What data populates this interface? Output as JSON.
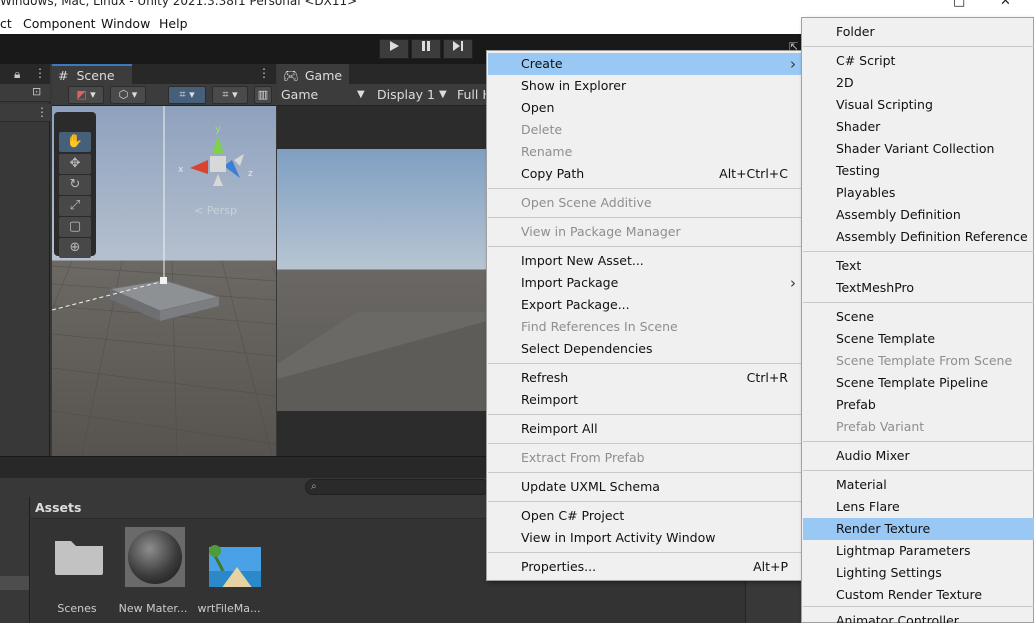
{
  "window": {
    "title": "Windows, Mac, Linux - Unity 2021.3.38f1 Personal <DX11>",
    "minimize_glyph": "□",
    "close_glyph": "✕"
  },
  "menubar": [
    "ct",
    "Component",
    "Window",
    "Help"
  ],
  "toolbar": {
    "play_icon": "play-icon",
    "pause_icon": "pause-icon",
    "step_icon": "step-icon"
  },
  "scene": {
    "tab_label": "Scene",
    "persp_label": "< Persp",
    "gizmo": {
      "x": "x",
      "y": "y",
      "z": "z"
    }
  },
  "game": {
    "tab_label": "Game",
    "mode": "Game",
    "display": "Display 1",
    "aspect": "Full H"
  },
  "project": {
    "header": "Assets",
    "search_placeholder": "",
    "assets": [
      {
        "name": "Scenes",
        "icon": "folder-icon"
      },
      {
        "name": "New Mater...",
        "icon": "material-sphere-icon"
      },
      {
        "name": "wrtFileMa...",
        "icon": "video-clip-icon"
      }
    ]
  },
  "context_menu": {
    "items": [
      {
        "label": "Create",
        "submenu": true,
        "highlighted": true
      },
      {
        "label": "Show in Explorer"
      },
      {
        "label": "Open"
      },
      {
        "label": "Delete",
        "disabled": true
      },
      {
        "label": "Rename",
        "disabled": true
      },
      {
        "label": "Copy Path",
        "shortcut": "Alt+Ctrl+C"
      },
      {
        "label": "Open Scene Additive",
        "disabled": true
      },
      {
        "label": "View in Package Manager",
        "disabled": true
      },
      {
        "label": "Import New Asset..."
      },
      {
        "label": "Import Package",
        "submenu": true
      },
      {
        "label": "Export Package..."
      },
      {
        "label": "Find References In Scene",
        "disabled": true
      },
      {
        "label": "Select Dependencies"
      },
      {
        "label": "Refresh",
        "shortcut": "Ctrl+R"
      },
      {
        "label": "Reimport"
      },
      {
        "label": "Reimport All"
      },
      {
        "label": "Extract From Prefab",
        "disabled": true
      },
      {
        "label": "Update UXML Schema"
      },
      {
        "label": "Open C# Project"
      },
      {
        "label": "View in Import Activity Window"
      },
      {
        "label": "Properties...",
        "shortcut": "Alt+P"
      }
    ]
  },
  "create_submenu": {
    "items": [
      {
        "label": "Folder"
      },
      {
        "label": "C# Script"
      },
      {
        "label": "2D"
      },
      {
        "label": "Visual Scripting"
      },
      {
        "label": "Shader"
      },
      {
        "label": "Shader Variant Collection"
      },
      {
        "label": "Testing"
      },
      {
        "label": "Playables"
      },
      {
        "label": "Assembly Definition"
      },
      {
        "label": "Assembly Definition Reference"
      },
      {
        "label": "Text"
      },
      {
        "label": "TextMeshPro"
      },
      {
        "label": "Scene"
      },
      {
        "label": "Scene Template"
      },
      {
        "label": "Scene Template From Scene",
        "disabled": true
      },
      {
        "label": "Scene Template Pipeline"
      },
      {
        "label": "Prefab"
      },
      {
        "label": "Prefab Variant",
        "disabled": true
      },
      {
        "label": "Audio Mixer"
      },
      {
        "label": "Material"
      },
      {
        "label": "Lens Flare"
      },
      {
        "label": "Render Texture",
        "highlighted": true
      },
      {
        "label": "Lightmap Parameters"
      },
      {
        "label": "Lighting Settings"
      },
      {
        "label": "Custom Render Texture"
      },
      {
        "label": "Animator Controller"
      }
    ]
  },
  "colors": {
    "menu_bg": "#f0f0f0",
    "menu_highlight": "#99c8f5",
    "editor_bg": "#383838",
    "toolbar_bg": "#191919",
    "disabled_text": "#8e8e8e"
  }
}
